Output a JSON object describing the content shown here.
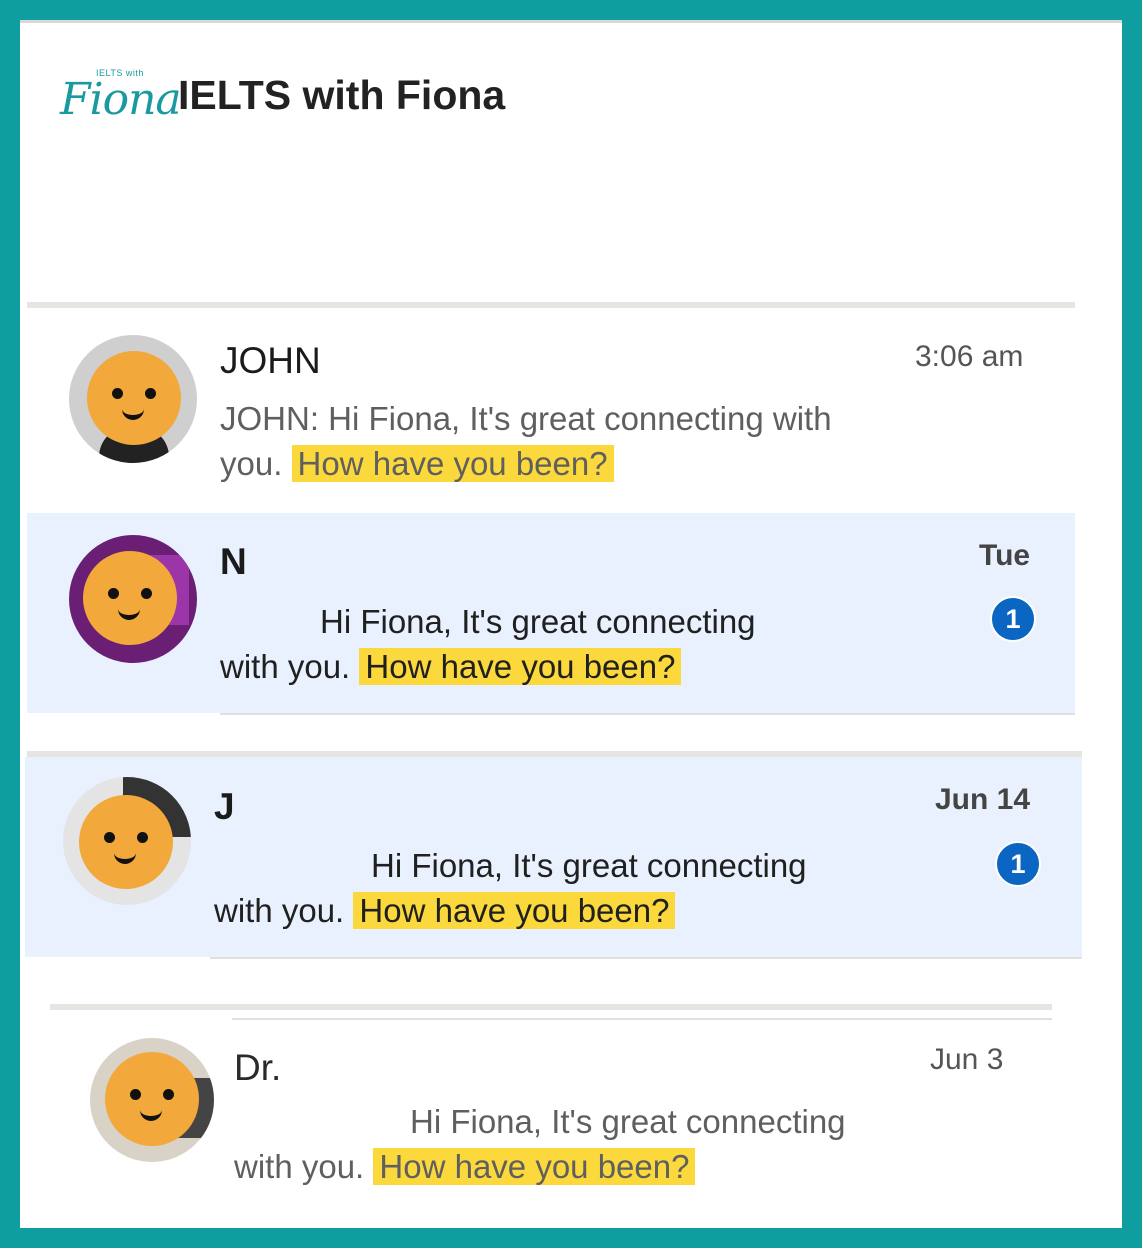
{
  "header": {
    "logo_small_text": "IELTS with",
    "logo_script_text": "Fiona",
    "title": "IELTS with Fiona"
  },
  "conversations": [
    {
      "name": "JOHN",
      "time": "3:06 am",
      "preview_line1": "JOHN: Hi Fiona, It's great connecting with",
      "preview_line2_prefix": "you.",
      "preview_highlight": "How have you been?",
      "unread_count": null
    },
    {
      "name": "N",
      "time": "Tue",
      "preview_line1": "Hi Fiona, It's great connecting",
      "preview_line2_prefix": "with you.",
      "preview_highlight": "How have you been?",
      "unread_count": "1"
    },
    {
      "name": "J",
      "time": "Jun 14",
      "preview_line1": "Hi Fiona, It's great connecting",
      "preview_line2_prefix": "with you.",
      "preview_highlight": "How have you been?",
      "unread_count": "1"
    },
    {
      "name": "Dr.",
      "time": "Jun 3",
      "preview_line1": "Hi Fiona, It's great connecting",
      "preview_line2_prefix": "with you.",
      "preview_highlight": "How have you been?",
      "unread_count": null
    }
  ],
  "colors": {
    "frame": "#0f9ea0",
    "unread_background": "#e8f1fd",
    "highlight": "#fbd93c",
    "badge": "#0a66c2",
    "emoji_face": "#f2a83a"
  }
}
